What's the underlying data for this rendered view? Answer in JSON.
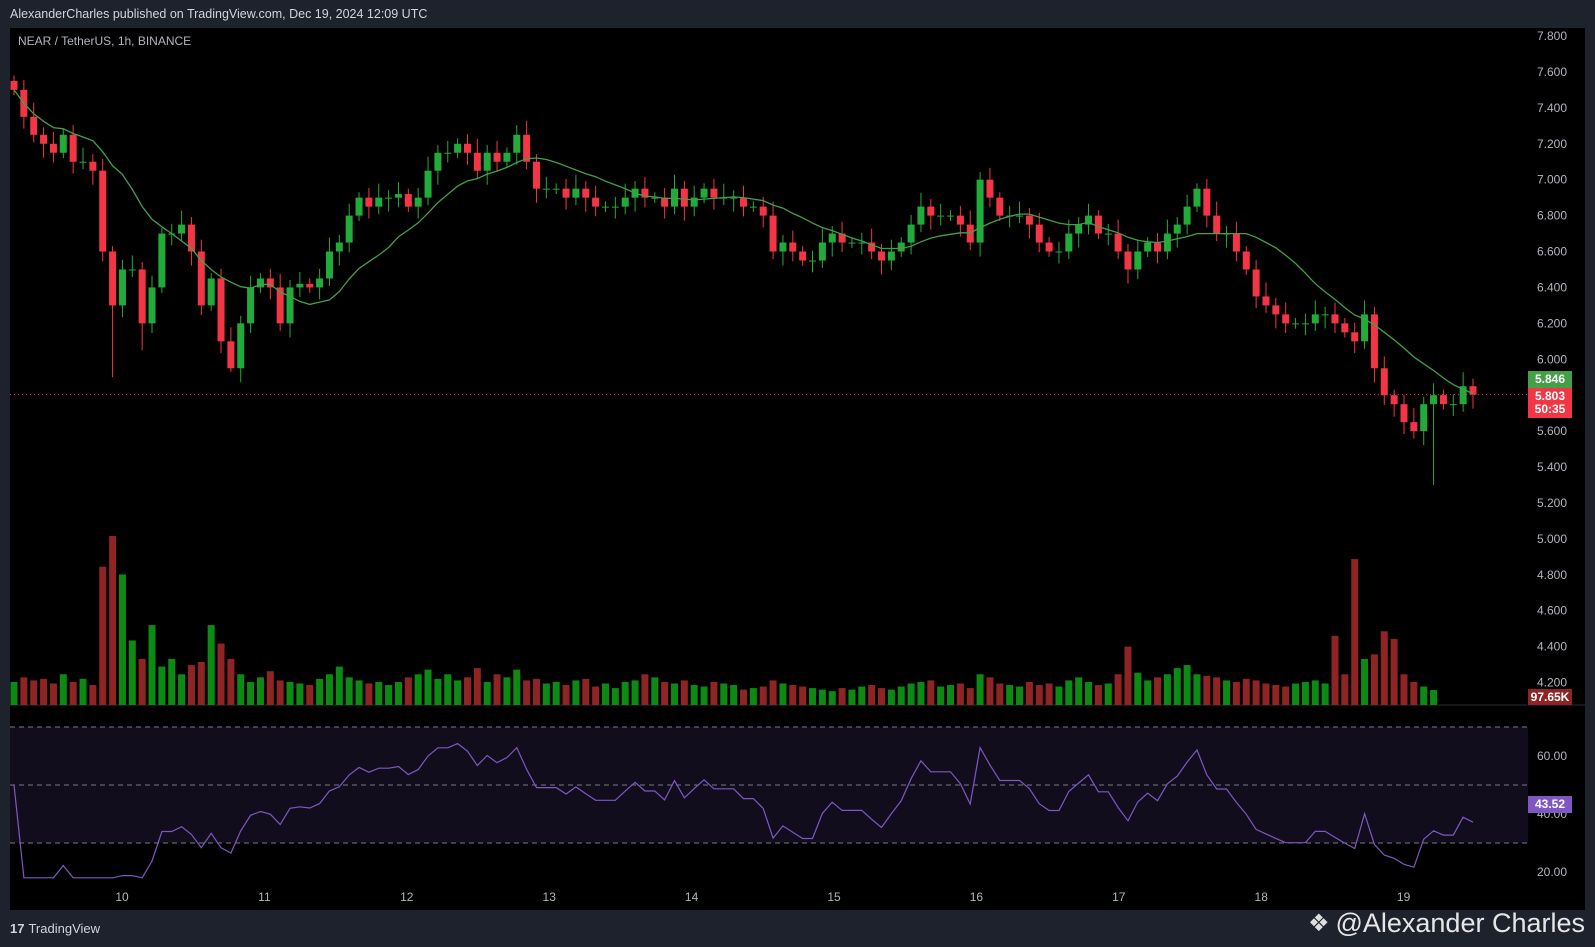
{
  "header": {
    "published_text": "AlexanderCharles published on TradingView.com, Dec 19, 2024 12:09 UTC"
  },
  "symbol_legend": "NEAR / TetherUS, 1h, BINANCE",
  "price_axis_ticks": [
    "7.800",
    "7.600",
    "7.400",
    "7.200",
    "7.000",
    "6.800",
    "6.600",
    "6.400",
    "6.200",
    "6.000",
    "5.600",
    "5.400",
    "5.200",
    "5.000",
    "4.800",
    "4.600",
    "4.400",
    "4.200"
  ],
  "labels": {
    "ma_value": "5.846",
    "last_price": "5.803",
    "countdown": "50:35",
    "volume_value": "97.65K",
    "rsi_value": "43.52"
  },
  "rsi_axis_ticks": [
    "60.00",
    "40.00",
    "20.00"
  ],
  "time_axis_ticks": [
    "10",
    "11",
    "12",
    "13",
    "14",
    "15",
    "16",
    "17",
    "18",
    "19"
  ],
  "footer": {
    "brand": "TradingView",
    "watermark": "@Alexander Charles"
  },
  "colors": {
    "up": "#22ab3a",
    "down": "#f23645",
    "vol_up": "#0d8a14",
    "vol_down": "#8e2424",
    "ma": "#43a047",
    "rsi": "#7e57c2",
    "ma_label": "#43a047",
    "price_label": "#f23645",
    "vol_label": "#8e2424",
    "rsi_label": "#7e57c2"
  },
  "chart_data": {
    "type": "candlestick",
    "title": "NEAR / TetherUS, 1h, BINANCE",
    "ylim": [
      4.0,
      7.85
    ],
    "closes": [
      7.5,
      7.35,
      7.25,
      7.2,
      7.15,
      7.25,
      7.1,
      7.1,
      7.05,
      6.6,
      6.3,
      6.5,
      6.5,
      6.2,
      6.4,
      6.7,
      6.7,
      6.75,
      6.6,
      6.3,
      6.45,
      6.1,
      5.95,
      6.2,
      6.4,
      6.45,
      6.4,
      6.2,
      6.4,
      6.42,
      6.4,
      6.45,
      6.6,
      6.65,
      6.8,
      6.9,
      6.85,
      6.9,
      6.9,
      6.92,
      6.85,
      6.9,
      7.05,
      7.15,
      7.15,
      7.2,
      7.15,
      7.05,
      7.15,
      7.1,
      7.15,
      7.25,
      7.1,
      6.95,
      6.95,
      6.95,
      6.9,
      6.95,
      6.9,
      6.85,
      6.85,
      6.85,
      6.9,
      6.95,
      6.9,
      6.9,
      6.85,
      6.95,
      6.85,
      6.9,
      6.95,
      6.9,
      6.9,
      6.9,
      6.85,
      6.85,
      6.8,
      6.6,
      6.65,
      6.6,
      6.55,
      6.55,
      6.65,
      6.7,
      6.65,
      6.65,
      6.65,
      6.6,
      6.55,
      6.6,
      6.65,
      6.75,
      6.85,
      6.8,
      6.8,
      6.8,
      6.75,
      6.65,
      7.0,
      6.9,
      6.8,
      6.8,
      6.8,
      6.75,
      6.65,
      6.6,
      6.6,
      6.7,
      6.75,
      6.8,
      6.7,
      6.7,
      6.6,
      6.5,
      6.6,
      6.65,
      6.6,
      6.7,
      6.75,
      6.85,
      6.95,
      6.8,
      6.7,
      6.7,
      6.6,
      6.5,
      6.35,
      6.3,
      6.25,
      6.2,
      6.2,
      6.2,
      6.25,
      6.25,
      6.2,
      6.15,
      6.1,
      6.25,
      5.95,
      5.8,
      5.75,
      5.65,
      5.6,
      5.75,
      5.8,
      5.75,
      5.75,
      5.85,
      5.803
    ],
    "wick_lows": [
      {
        "i": 10,
        "low": 5.9
      },
      {
        "i": 13,
        "low": 6.05
      },
      {
        "i": 22,
        "low": 5.93
      },
      {
        "i": 144,
        "low": 5.3
      },
      {
        "i": 140,
        "low": 5.68
      }
    ],
    "volumes_k": [
      150,
      180,
      160,
      170,
      140,
      200,
      150,
      170,
      130,
      900,
      1100,
      850,
      420,
      300,
      520,
      250,
      300,
      200,
      260,
      280,
      520,
      400,
      300,
      200,
      150,
      180,
      220,
      160,
      150,
      140,
      130,
      170,
      200,
      250,
      180,
      160,
      140,
      150,
      130,
      150,
      180,
      200,
      230,
      170,
      200,
      160,
      180,
      240,
      150,
      200,
      180,
      230,
      160,
      170,
      140,
      150,
      130,
      160,
      170,
      120,
      140,
      110,
      150,
      160,
      200,
      180,
      150,
      140,
      160,
      130,
      120,
      150,
      140,
      130,
      100,
      110,
      120,
      160,
      140,
      130,
      120,
      110,
      100,
      90,
      110,
      100,
      120,
      130,
      110,
      100,
      120,
      140,
      150,
      160,
      120,
      130,
      140,
      110,
      200,
      180,
      140,
      130,
      120,
      150,
      130,
      140,
      120,
      160,
      180,
      150,
      130,
      140,
      200,
      380,
      210,
      160,
      180,
      200,
      240,
      260,
      200,
      190,
      180,
      160,
      150,
      170,
      160,
      140,
      130,
      120,
      140,
      150,
      160,
      140,
      450,
      200,
      950,
      300,
      330,
      480,
      430,
      200,
      150,
      120,
      97.65
    ],
    "ma_period": 12,
    "rsi_period": 14,
    "rsi_levels": [
      70,
      50,
      30
    ],
    "rsi_ylim": [
      14,
      76
    ]
  }
}
